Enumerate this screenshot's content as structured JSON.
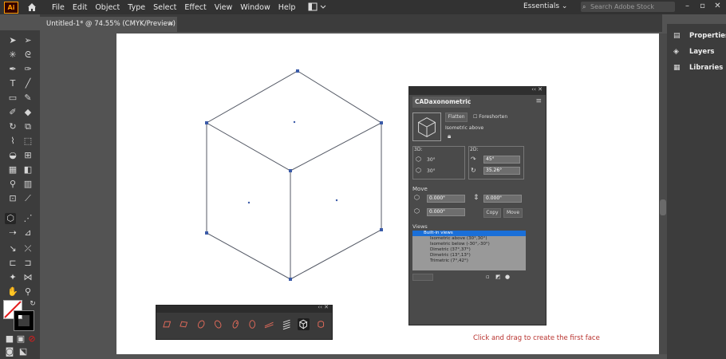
{
  "menubar": {
    "logo": "Ai",
    "items": [
      "File",
      "Edit",
      "Object",
      "Type",
      "Select",
      "Effect",
      "View",
      "Window",
      "Help"
    ],
    "workspace": "Essentials",
    "search_placeholder": "Search Adobe Stock"
  },
  "document": {
    "tab_title": "Untitled-1* @ 74.55% (CMYK/Preview)"
  },
  "dock": {
    "items": [
      "Properties",
      "Layers",
      "Libraries"
    ]
  },
  "cad_panel": {
    "title": "CADaxonometric",
    "flatten_label": "Flatten",
    "foreshorten_label": "Foreshorten",
    "view_name": "Isometric above",
    "group_3d_label": "3D:",
    "group_2d_label": "2D:",
    "angle_a": "30°",
    "angle_b": "30°",
    "angle_c": "45°",
    "angle_d": "35.26°",
    "move_label": "Move",
    "move_x": "0.000\"",
    "move_y": "0.000\"",
    "move_z": "0.000\"",
    "copy_label": "Copy",
    "move_btn_label": "Move",
    "views_label": "Views",
    "views": [
      "Built-in views",
      "Isometric above (30°,30°)",
      "Isometric below (-30°,-30°)",
      "Dimetric (37°,37°)",
      "Dimetric (13°,13°)",
      "Trimetric (7°,42°)"
    ]
  },
  "status_text": "Click and drag to create the first face",
  "colors": {
    "accent": "#1a6fd8",
    "status": "#b8322e",
    "path": "#3b5ba8"
  }
}
